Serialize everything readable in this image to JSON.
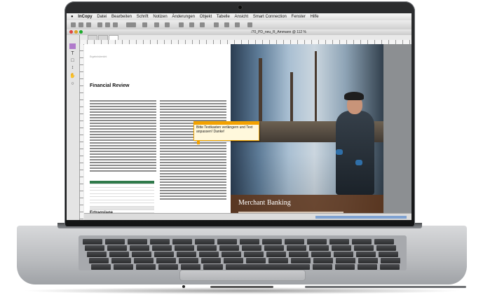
{
  "menubar": {
    "apple": "",
    "app_name": "InCopy",
    "items": [
      "Datei",
      "Bearbeiten",
      "Schrift",
      "Notizen",
      "Änderungen",
      "Objekt",
      "Tabelle",
      "Ansicht",
      "Smart Connection",
      "Fenster",
      "Hilfe"
    ]
  },
  "window": {
    "title": "/70_PD_neu_R_Ammann @ 112 %"
  },
  "document": {
    "running_head": "Ergebnisbericht",
    "heading": "Financial Review",
    "subheading": "Ertragslage",
    "photo_title": "Merchant Banking"
  },
  "note": {
    "text": "Bitte Textkasten verlängern und Text anpassen! Danke!"
  },
  "colors": {
    "note_accent": "#f3a100",
    "banner": "#60371c",
    "table_header": "#2f7a4a"
  }
}
